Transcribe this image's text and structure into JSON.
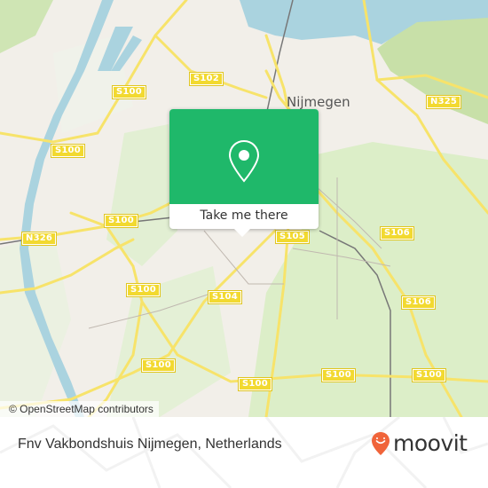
{
  "map": {
    "city_label": "Nijmegen",
    "road_shields": [
      {
        "id": "s100-a",
        "label": "S100"
      },
      {
        "id": "s102",
        "label": "S102"
      },
      {
        "id": "s100-b",
        "label": "S100"
      },
      {
        "id": "s100-c",
        "label": "S100"
      },
      {
        "id": "n326",
        "label": "N326"
      },
      {
        "id": "n325",
        "label": "N325"
      },
      {
        "id": "s105",
        "label": "S105"
      },
      {
        "id": "s106-a",
        "label": "S106"
      },
      {
        "id": "s106-b",
        "label": "S106"
      },
      {
        "id": "s100-d",
        "label": "S100"
      },
      {
        "id": "s104",
        "label": "S104"
      },
      {
        "id": "s100-e",
        "label": "S100"
      },
      {
        "id": "s100-f",
        "label": "S100"
      },
      {
        "id": "s100-g",
        "label": "S100"
      },
      {
        "id": "s100-h",
        "label": "S100"
      }
    ],
    "attribution": "© OpenStreetMap contributors"
  },
  "popup": {
    "icon": "map-pin-icon",
    "button_label": "Take me there",
    "accent_color": "#1fb86a"
  },
  "footer": {
    "place_name": "Fnv Vakbondshuis Nijmegen, Netherlands",
    "brand": "moovit",
    "brand_color": "#f0643a"
  }
}
